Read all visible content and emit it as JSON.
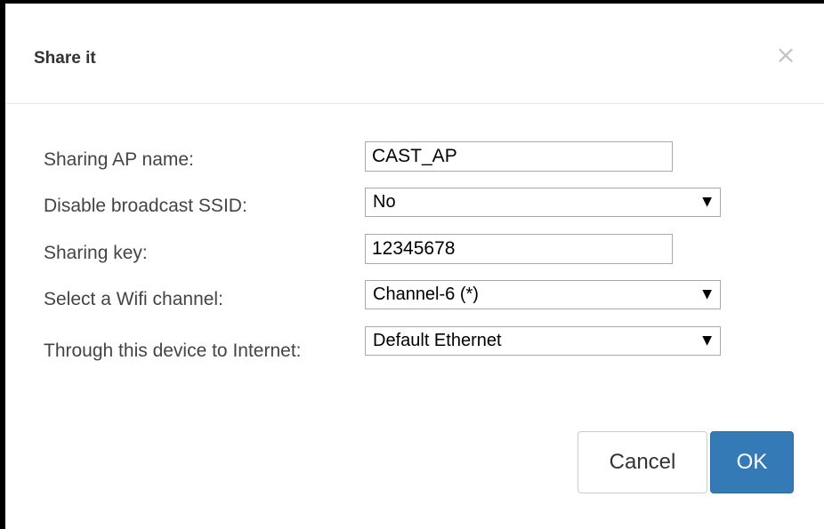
{
  "dialog": {
    "title": "Share it",
    "close_label": "×"
  },
  "form": {
    "ap_name": {
      "label": "Sharing AP name:",
      "value": "CAST_AP"
    },
    "disable_ssid": {
      "label": "Disable broadcast SSID:",
      "value": "No"
    },
    "sharing_key": {
      "label": "Sharing key:",
      "value": "12345678"
    },
    "wifi_channel": {
      "label": "Select a Wifi channel:",
      "value": "Channel-6 (*)"
    },
    "internet_device": {
      "label": "Through this device to Internet:",
      "value": "Default Ethernet"
    },
    "dropdown_arrow": "▼"
  },
  "buttons": {
    "cancel_label": "Cancel",
    "ok_label": "OK"
  },
  "colors": {
    "primary": "#337ab7",
    "frame": "#000000"
  }
}
